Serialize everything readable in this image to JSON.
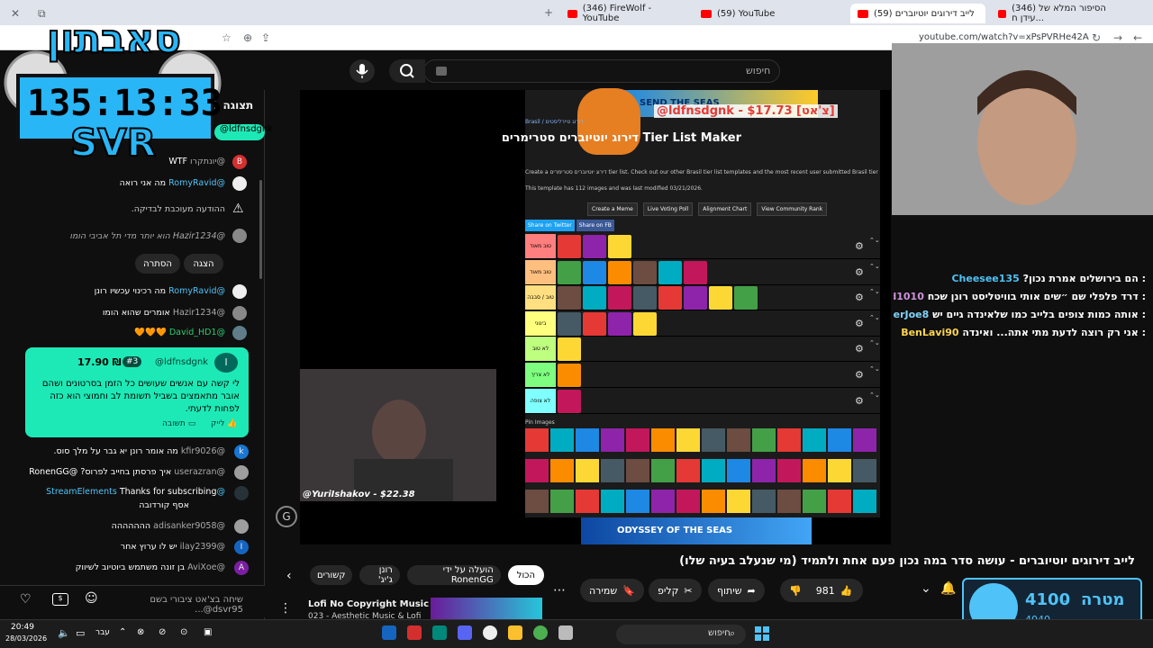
{
  "browser": {
    "tabs": [
      {
        "label": "(346) הסיפור המלא של עידן ח..."
      },
      {
        "label": "(59) לייב דירוגים יוטיוברים"
      },
      {
        "label": "(59) YouTube"
      },
      {
        "label": "(346) FireWolf - YouTube"
      }
    ],
    "url": "youtube.com/watch?v=xPsPVRHe42A"
  },
  "search": {
    "placeholder": "חיפוש"
  },
  "overlay": {
    "timer": "135:13:33",
    "svr": "SVR",
    "logo": "סאבתון"
  },
  "chat": {
    "header": "תצוגה ב",
    "messages": [
      {
        "author": "@יונתקרו",
        "text": "WTF",
        "avatar_color": "#d32f2f",
        "initial": "B"
      },
      {
        "author": "@RomyRavid",
        "text": "מה אני רואה",
        "avatar_color": "#eeeeee",
        "initial": ""
      },
      {
        "author": "",
        "text": "ההודעה מעוכבת לבדיקה.",
        "avatar_color": "",
        "initial": "⚠"
      },
      {
        "author": "@Hazir1234",
        "text": "הוא יותר מדי תל אביבי הומו",
        "avatar_color": "#888",
        "initial": ""
      }
    ],
    "held_buttons": {
      "show": "הצגה",
      "hide": "הסתרה"
    },
    "messages2": [
      {
        "author": "@RomyRavid",
        "text": "מה רכינוי עכשיו רונן",
        "avatar_color": "#eeeeee"
      },
      {
        "author": "@Hazir1234",
        "text": "אומרים שהוא הומו",
        "avatar_color": "#888"
      },
      {
        "author": "@David_HD1",
        "text": "🧡🧡🧡",
        "avatar_color": "#607d8b"
      }
    ],
    "superchat": {
      "author": "@ldfnsdgnk",
      "badge": "#3",
      "amount": "17.90 ₪",
      "text": "לי קשה עם אנשים שעושים כל הזמן בסרטונים ושהם אובר מתאמצים בשביל תשומת לב וחמוצי הוא כזה לפחות לדעתי.",
      "like": "לייק",
      "reply": "תשובה"
    },
    "messages3": [
      {
        "author": "@kfir9026",
        "text": "מה אומר רונן יא גבר על מלך סוס.",
        "avatar_color": "#1976d2",
        "initial": "k"
      },
      {
        "author": "@userazran",
        "text": "איך פרסתן בחייב לפרוס? @RonenGG",
        "avatar_color": "#9e9e9e",
        "initial": ""
      },
      {
        "author": "@StreamElements",
        "text": "Thanks for subscribing",
        "avatar_color": "#263238",
        "initial": ""
      },
      {
        "author": "",
        "text": "אסף קורדובה",
        "avatar_color": "",
        "initial": ""
      },
      {
        "author": "@adisanker9058",
        "text": "ההההההה",
        "avatar_color": "#9e9e9e",
        "initial": ""
      },
      {
        "author": "@ilay2399",
        "text": "יש לו ערוץ אחר",
        "avatar_color": "#1565c0",
        "initial": "I"
      },
      {
        "author": "@AviXoe",
        "text": "בן זונה משתמש ביוטיוב לשיווק",
        "avatar_color": "#7b1fa2",
        "initial": "A"
      }
    ],
    "input_placeholder": "שיחה בצ'אט ציבורי בשם dsvr95@..."
  },
  "tierlist": {
    "breadcrumb": "Brasil / דירוג טיירליסטים",
    "heading": "Tier List Maker דירוג יוטיוברים סטרימרים",
    "desc": "Create a דירוג יוטיוברים סטרימרים tier list. Check out our other Brasil tier list templates and the most recent user submitted Brasil tier lists.",
    "stats": "This template has 112 images and was last modified 03/21/2026.",
    "buttons": [
      "Create a Meme",
      "Live Voting Poll",
      "Alignment Chart",
      "View Community Rank"
    ],
    "share": [
      "Share on Twitter",
      "Share on FB"
    ],
    "tiers": [
      {
        "label": "טוב מאוד",
        "color": "#ff7f7f",
        "count": 3
      },
      {
        "label": "טוב מאוד",
        "color": "#ffbf7f",
        "count": 6
      },
      {
        "label": "טוב / סבבה",
        "color": "#ffdf7f",
        "count": 8
      },
      {
        "label": "בינוני",
        "color": "#ffff7f",
        "count": 4
      },
      {
        "label": "לא טוב",
        "color": "#bfff7f",
        "count": 1
      },
      {
        "label": "לא צריך",
        "color": "#7fff7f",
        "count": 1
      },
      {
        "label": "לא צופה",
        "color": "#7fffff",
        "count": 1
      }
    ],
    "pin_images": "Pin Images",
    "ad_top": "SEND THE SEAS",
    "ad_bottom": "ODYSSEY OF THE SEAS"
  },
  "overlay_chat": {
    "donation": "@ldfnsdgnk - $17.73 [צ'אט]",
    "lines": [
      {
        "author": "Cheesee135",
        "text": ": הם בירושלים אמרת נכון?"
      },
      {
        "author": "Liad1010",
        "text": ": דרד פלפלי שם ״שים אותי בוויטליסט רונן שכח"
      },
      {
        "author": "SpiderJoe8",
        "text": ": אותה כמות צופים בלייב כמו שלאינדה גיים יש"
      },
      {
        "author": "BenLavi90",
        "text": ": אני רק רוצה לדעת מתי אתה... ואינדה"
      }
    ]
  },
  "webcam": {
    "caption": "@YuriIshakov - $22.38"
  },
  "video": {
    "title": "לייב דירוגים יוטיוברים - עושה סדר במה נכון פעם אחת ולתמיד (מי שנעלב בעיה שלו)",
    "chips": [
      "הכול",
      "הועלה על ידי RonenGG",
      "רונן ג'יג'",
      "קשורים"
    ],
    "actions": {
      "likes": "981",
      "share": "שיתוף",
      "clip": "קליפ",
      "save": "שמירה"
    },
    "next_title": "Lofi No Copyright Music Mix",
    "next_sub": "023 - Aesthetic Music & Lofi"
  },
  "goal": {
    "label": "מטרה",
    "current": "4100",
    "previous": "4040"
  },
  "taskbar": {
    "time": "20:49",
    "date": "28/03/2026",
    "lang": "עבר",
    "search": "חיפוש"
  }
}
